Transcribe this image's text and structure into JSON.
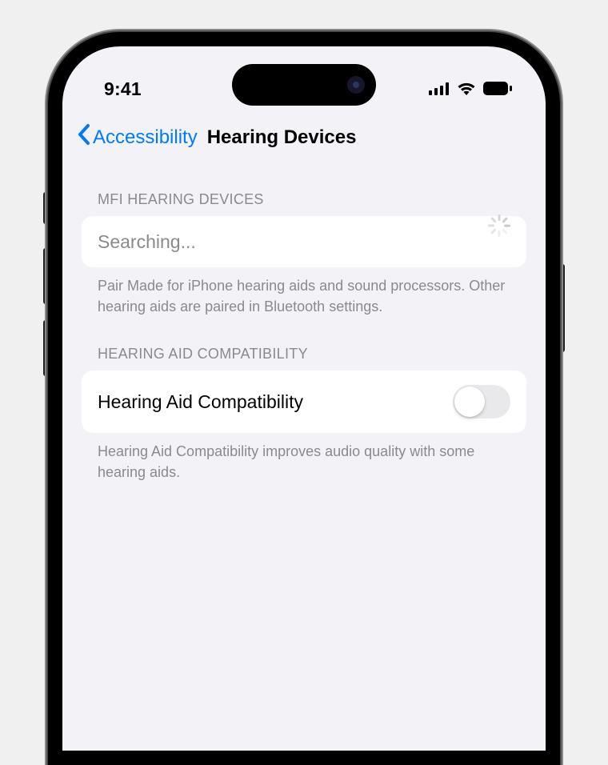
{
  "status_bar": {
    "time": "9:41"
  },
  "nav": {
    "back_label": "Accessibility",
    "title": "Hearing Devices"
  },
  "sections": {
    "mfi": {
      "header": "MFI HEARING DEVICES",
      "status_label": "Searching...",
      "footer": "Pair Made for iPhone hearing aids and sound processors. Other hearing aids are paired in Bluetooth settings."
    },
    "compat": {
      "header": "HEARING AID COMPATIBILITY",
      "row_label": "Hearing Aid Compatibility",
      "toggle_on": false,
      "footer": "Hearing Aid Compatibility improves audio quality with some hearing aids."
    }
  }
}
